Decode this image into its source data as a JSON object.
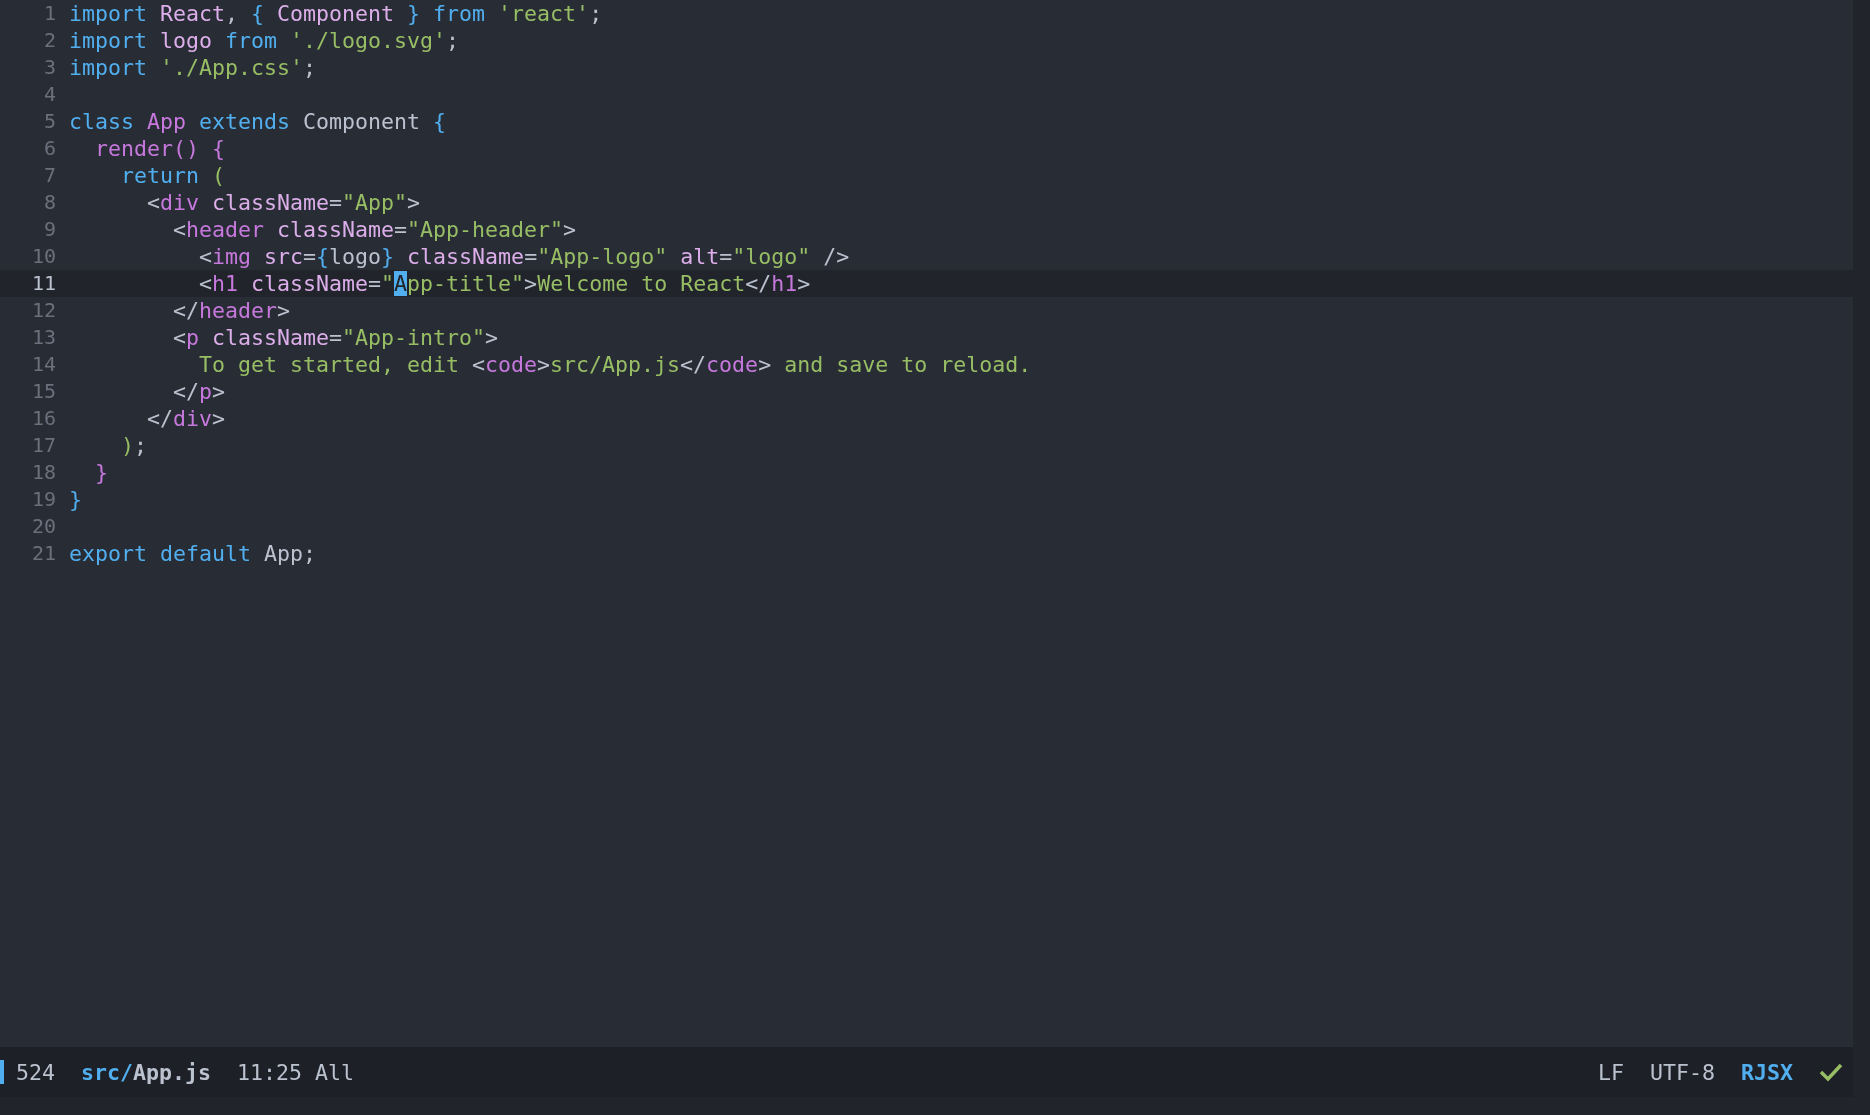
{
  "lines": [
    {
      "number": "1",
      "current": false,
      "tokens": [
        {
          "kind": "kw",
          "text": "import "
        },
        {
          "kind": "var",
          "text": "React"
        },
        {
          "kind": "plain",
          "text": ", "
        },
        {
          "kind": "d1",
          "text": "{ "
        },
        {
          "kind": "var",
          "text": "Component"
        },
        {
          "kind": "d1",
          "text": " }"
        },
        {
          "kind": "kw",
          "text": " from "
        },
        {
          "kind": "str",
          "text": "'react'"
        },
        {
          "kind": "plain",
          "text": ";"
        }
      ]
    },
    {
      "number": "2",
      "current": false,
      "tokens": [
        {
          "kind": "kw",
          "text": "import "
        },
        {
          "kind": "var",
          "text": "logo"
        },
        {
          "kind": "kw",
          "text": " from "
        },
        {
          "kind": "str",
          "text": "'./logo.svg'"
        },
        {
          "kind": "plain",
          "text": ";"
        }
      ]
    },
    {
      "number": "3",
      "current": false,
      "tokens": [
        {
          "kind": "kw",
          "text": "import "
        },
        {
          "kind": "str",
          "text": "'./App.css'"
        },
        {
          "kind": "plain",
          "text": ";"
        }
      ]
    },
    {
      "number": "4",
      "current": false
    },
    {
      "number": "5",
      "current": false,
      "tokens": [
        {
          "kind": "kw",
          "text": "class "
        },
        {
          "kind": "type",
          "text": "App"
        },
        {
          "kind": "kw",
          "text": " extends "
        },
        {
          "kind": "plain",
          "text": "Component "
        },
        {
          "kind": "d1",
          "text": "{"
        }
      ]
    },
    {
      "number": "6",
      "current": false,
      "tokens": [
        {
          "kind": "fn",
          "text": "  render() {"
        }
      ]
    },
    {
      "number": "7",
      "current": false,
      "tokens": [
        {
          "kind": "kw",
          "text": "    return "
        },
        {
          "kind": "d3",
          "text": "("
        }
      ]
    },
    {
      "number": "8",
      "current": false,
      "tokens": [
        {
          "kind": "plain",
          "text": "      <"
        },
        {
          "kind": "tag",
          "text": "div"
        },
        {
          "kind": "attr",
          "text": " className"
        },
        {
          "kind": "plain",
          "text": "="
        },
        {
          "kind": "str",
          "text": "\"App\""
        },
        {
          "kind": "plain",
          "text": ">"
        }
      ]
    },
    {
      "number": "9",
      "current": false,
      "tokens": [
        {
          "kind": "plain",
          "text": "        <"
        },
        {
          "kind": "tag",
          "text": "header"
        },
        {
          "kind": "attr",
          "text": " className"
        },
        {
          "kind": "plain",
          "text": "="
        },
        {
          "kind": "str",
          "text": "\"App-header\""
        },
        {
          "kind": "plain",
          "text": ">"
        }
      ]
    },
    {
      "number": "10",
      "current": false,
      "tokens": [
        {
          "kind": "plain",
          "text": "          <"
        },
        {
          "kind": "tag",
          "text": "img"
        },
        {
          "kind": "attr",
          "text": " src"
        },
        {
          "kind": "plain",
          "text": "="
        },
        {
          "kind": "d1",
          "text": "{"
        },
        {
          "kind": "plain",
          "text": "logo"
        },
        {
          "kind": "d1",
          "text": "}"
        },
        {
          "kind": "attr",
          "text": " className"
        },
        {
          "kind": "plain",
          "text": "="
        },
        {
          "kind": "str",
          "text": "\"App-logo\""
        },
        {
          "kind": "attr",
          "text": " alt"
        },
        {
          "kind": "plain",
          "text": "="
        },
        {
          "kind": "str",
          "text": "\"logo\""
        },
        {
          "kind": "plain",
          "text": " />"
        }
      ]
    },
    {
      "number": "11",
      "current": true,
      "tokens": [
        {
          "kind": "plain",
          "text": "          <"
        },
        {
          "kind": "tag",
          "text": "h1"
        },
        {
          "kind": "attr",
          "text": " className"
        },
        {
          "kind": "plain",
          "text": "="
        },
        {
          "kind": "str",
          "text": "\""
        },
        {
          "kind": "cursor",
          "text": "A"
        },
        {
          "kind": "str",
          "text": "pp-title\""
        },
        {
          "kind": "plain",
          "text": ">"
        },
        {
          "kind": "str",
          "text": "Welcome to React"
        },
        {
          "kind": "plain",
          "text": "</"
        },
        {
          "kind": "tag",
          "text": "h1"
        },
        {
          "kind": "plain",
          "text": ">"
        }
      ]
    },
    {
      "number": "12",
      "current": false,
      "tokens": [
        {
          "kind": "plain",
          "text": "        </"
        },
        {
          "kind": "tag",
          "text": "header"
        },
        {
          "kind": "plain",
          "text": ">"
        }
      ]
    },
    {
      "number": "13",
      "current": false,
      "tokens": [
        {
          "kind": "plain",
          "text": "        <"
        },
        {
          "kind": "tag",
          "text": "p"
        },
        {
          "kind": "attr",
          "text": " className"
        },
        {
          "kind": "plain",
          "text": "="
        },
        {
          "kind": "str",
          "text": "\"App-intro\""
        },
        {
          "kind": "plain",
          "text": ">"
        }
      ]
    },
    {
      "number": "14",
      "current": false,
      "tokens": [
        {
          "kind": "str",
          "text": "          To get started, edit "
        },
        {
          "kind": "plain",
          "text": "<"
        },
        {
          "kind": "tag",
          "text": "code"
        },
        {
          "kind": "plain",
          "text": ">"
        },
        {
          "kind": "str",
          "text": "src/App.js"
        },
        {
          "kind": "plain",
          "text": "</"
        },
        {
          "kind": "tag",
          "text": "code"
        },
        {
          "kind": "plain",
          "text": ">"
        },
        {
          "kind": "str",
          "text": " and save to reload."
        }
      ]
    },
    {
      "number": "15",
      "current": false,
      "tokens": [
        {
          "kind": "plain",
          "text": "        </"
        },
        {
          "kind": "tag",
          "text": "p"
        },
        {
          "kind": "plain",
          "text": ">"
        }
      ]
    },
    {
      "number": "16",
      "current": false,
      "tokens": [
        {
          "kind": "plain",
          "text": "      </"
        },
        {
          "kind": "tag",
          "text": "div"
        },
        {
          "kind": "plain",
          "text": ">"
        }
      ]
    },
    {
      "number": "17",
      "current": false,
      "tokens": [
        {
          "kind": "d3",
          "text": "    )"
        },
        {
          "kind": "plain",
          "text": ";"
        }
      ]
    },
    {
      "number": "18",
      "current": false,
      "tokens": [
        {
          "kind": "d2",
          "text": "  }"
        }
      ]
    },
    {
      "number": "19",
      "current": false,
      "tokens": [
        {
          "kind": "d1",
          "text": "}"
        }
      ]
    },
    {
      "number": "20",
      "current": false
    },
    {
      "number": "21",
      "current": false,
      "tokens": [
        {
          "kind": "kw",
          "text": "export default "
        },
        {
          "kind": "plain",
          "text": "App;"
        }
      ]
    }
  ],
  "status_bar": {
    "buffer_size": "524",
    "directory": "src/",
    "file_name": "App.js",
    "position": "11:25",
    "scroll": "All",
    "line_ending": "LF",
    "encoding": "UTF-8",
    "mode": "RJSX",
    "checker_ok": true
  }
}
